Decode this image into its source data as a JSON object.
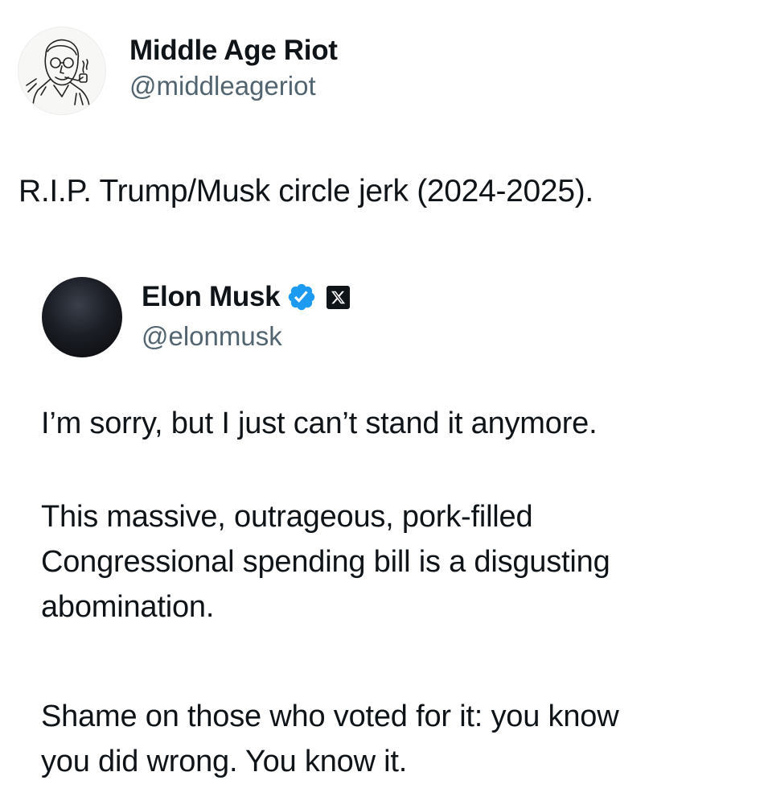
{
  "outer_tweet": {
    "display_name": "Middle Age Riot",
    "handle": "@middleageriot",
    "text": "R.I.P. Trump/Musk circle jerk (2024-2025)."
  },
  "quoted_tweet": {
    "display_name": "Elon Musk",
    "handle": "@elonmusk",
    "verified_icon": "verified-badge-icon",
    "affiliation_icon": "x-logo-icon",
    "paragraphs": [
      {
        "lines": [
          "I’m sorry, but I just can’t stand it anymore."
        ]
      },
      {
        "lines": [
          "This massive, outrageous, pork-filled",
          "Congressional spending bill is a disgusting",
          "abomination."
        ]
      },
      {
        "lines": [
          "Shame on those who voted for it: you know",
          "you did wrong. You know it."
        ]
      }
    ]
  },
  "colors": {
    "text": "#0f1419",
    "secondary_text": "#536471",
    "verified_blue": "#1d9bf0",
    "background": "#ffffff"
  }
}
